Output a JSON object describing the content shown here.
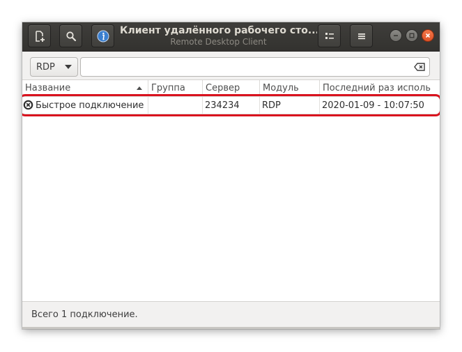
{
  "window": {
    "title": "Клиент удалённого рабочего сто...",
    "subtitle": "Remote Desktop Client"
  },
  "header_buttons": {
    "new_connection_icon": "new-document-icon",
    "search_icon": "search-icon",
    "about_icon": "info-icon",
    "view_icon": "list-view-icon",
    "menu_icon": "hamburger-menu-icon"
  },
  "toolbar": {
    "protocol_selected": "RDP",
    "search_value": "",
    "search_placeholder": ""
  },
  "table": {
    "columns": [
      "Название",
      "Группа",
      "Сервер",
      "Модуль",
      "Последний раз исполь"
    ],
    "rows": [
      {
        "name": "Быстрое подключение",
        "group": "",
        "server": "234234",
        "module": "RDP",
        "last_used": "2020-01-09 - 10:07:50"
      }
    ]
  },
  "status": {
    "text": "Всего 1 подключение."
  },
  "colors": {
    "headerbar": "#3a3936",
    "close_button": "#e95420",
    "highlight": "#d9121e"
  }
}
